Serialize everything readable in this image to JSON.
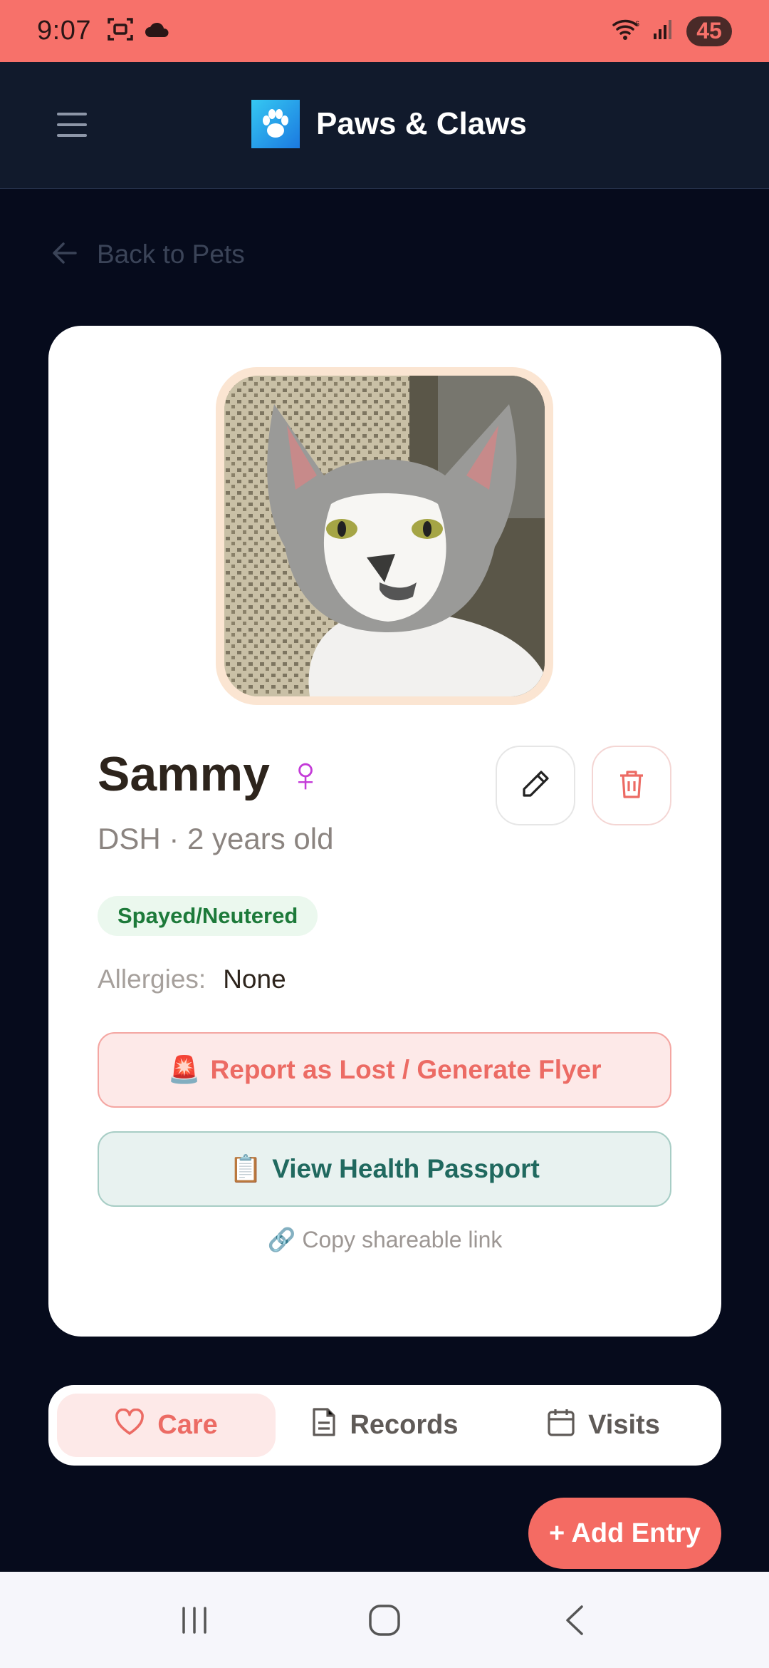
{
  "status_bar": {
    "time": "9:07",
    "battery": "45",
    "icons": [
      "screenshot-icon",
      "cloud-icon",
      "wifi-icon",
      "signal-icon"
    ]
  },
  "header": {
    "title": "Paws & Claws",
    "logo_icon": "paw-icon",
    "menu_icon": "hamburger-menu-icon"
  },
  "back": {
    "label": "Back to Pets"
  },
  "pet": {
    "name": "Sammy",
    "gender_symbol": "♀",
    "meta": "DSH · 2 years old",
    "badge": "Spayed/Neutered",
    "allergies_label": "Allergies:",
    "allergies_value": "None",
    "photo_description_icon": "cat-photo"
  },
  "actions": {
    "report_icon": "🚨",
    "report_label": "Report as Lost / Generate Flyer",
    "passport_icon": "📋",
    "passport_label": "View Health Passport",
    "share_icon": "🔗",
    "share_label": "Copy shareable link"
  },
  "tabs": [
    {
      "label": "Care",
      "icon": "heart-icon",
      "active": true
    },
    {
      "label": "Records",
      "icon": "document-icon",
      "active": false
    },
    {
      "label": "Visits",
      "icon": "calendar-icon",
      "active": false
    }
  ],
  "fab": {
    "label": "+ Add Entry"
  },
  "colors": {
    "accent": "#f46b63",
    "status_bar": "#f7716a",
    "background": "#060b1c",
    "header": "#111a2c",
    "badge_green": "#1d7a3a",
    "passport_teal": "#20695f"
  }
}
